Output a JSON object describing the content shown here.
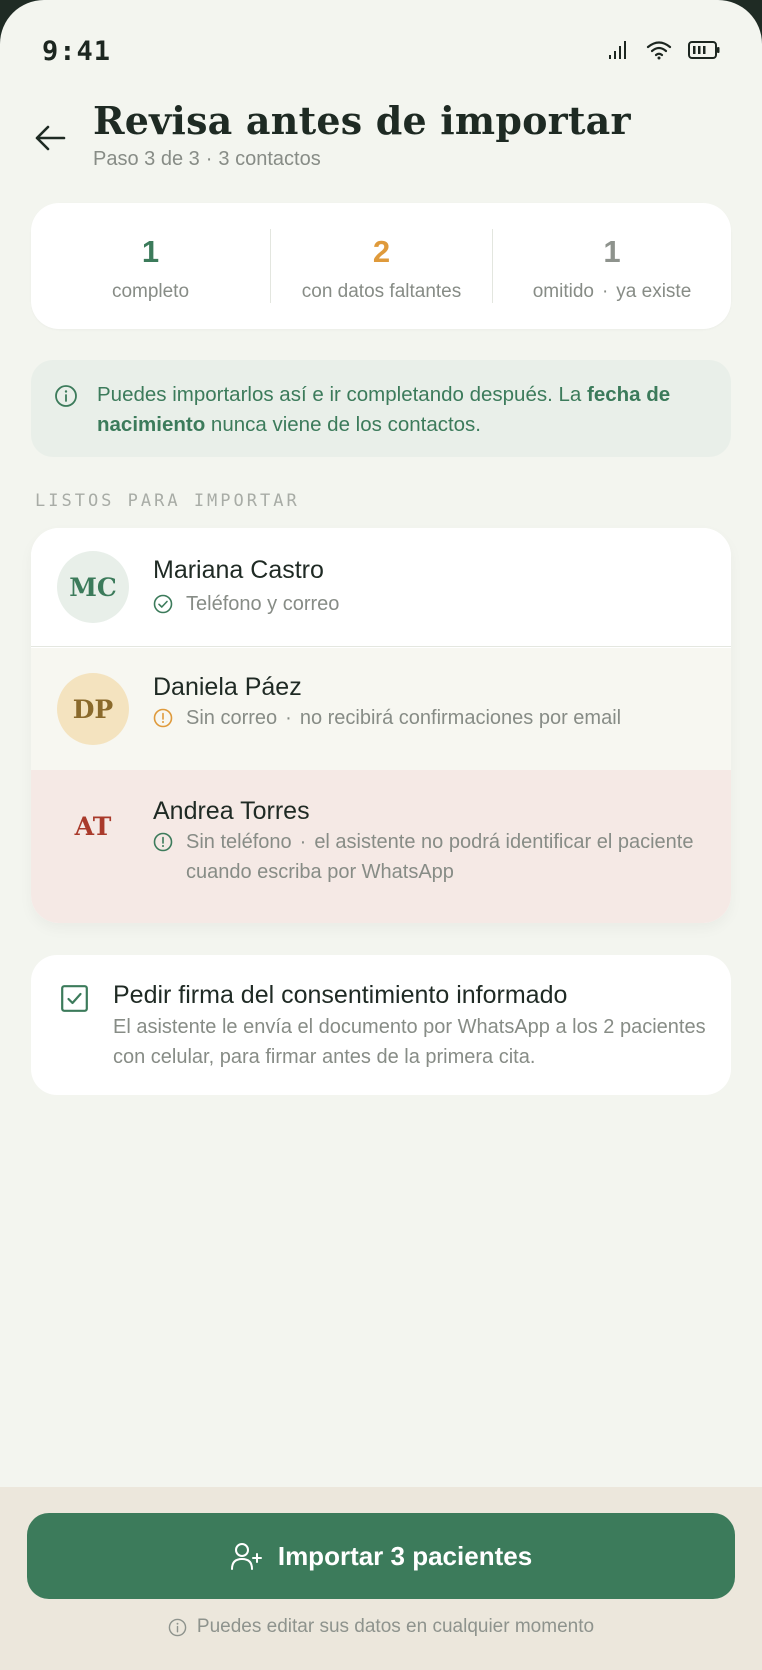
{
  "status_bar": {
    "time": "9:41"
  },
  "header": {
    "title": "Revisa antes de importar",
    "step": "Paso 3 de 3",
    "separator": "·",
    "contacts_count": "3 contactos"
  },
  "stats": [
    {
      "value": "1",
      "label": "completo",
      "color": "#3c7b5b"
    },
    {
      "value": "2",
      "label": "con datos faltantes",
      "color": "#df9a3b"
    },
    {
      "value": "1",
      "label_a": "omitido",
      "label_sep": "·",
      "label_b": "ya existe",
      "color": "#8e938d"
    }
  ],
  "info_banner": {
    "text_before": "Puedes importarlos así e ir completando después. La ",
    "bold": "fecha de nacimiento",
    "text_after": " nunca viene de los contactos."
  },
  "section_label": "LISTOS PARA IMPORTAR",
  "contacts": [
    {
      "initials": "MC",
      "name": "Mariana Castro",
      "detail": "Teléfono y correo",
      "status": "complete"
    },
    {
      "initials": "DP",
      "name": "Daniela Páez",
      "detail_a": "Sin correo",
      "detail_sep": "·",
      "detail_b": "no recibirá confirmaciones por email",
      "status": "warning"
    },
    {
      "initials": "AT",
      "name": "Andrea Torres",
      "detail_a": "Sin teléfono",
      "detail_sep": "·",
      "detail_b": "el asistente no podrá identificar el paciente cuando escriba por WhatsApp",
      "status": "missing"
    }
  ],
  "consent": {
    "checked": true,
    "title": "Pedir firma del consentimiento informado",
    "description": "El asistente le envía el documento por WhatsApp a los 2 pacientes con celular, para firmar antes de la primera cita."
  },
  "footer": {
    "import_button": "Importar 3 pacientes",
    "note": "Puedes editar sus datos en cualquier momento"
  },
  "colors": {
    "primary": "#3c7b5b",
    "warning": "#df9a3b",
    "danger": "#a93a2b",
    "background": "#f3f5ef"
  }
}
